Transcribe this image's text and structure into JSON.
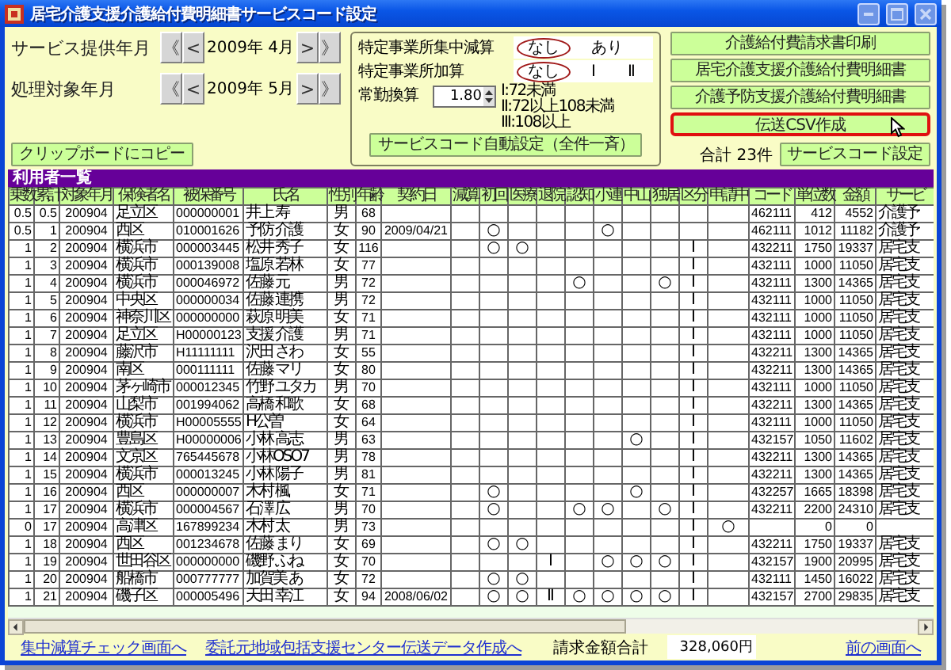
{
  "window": {
    "title": "居宅介護支援介護給付費明細書サービスコード設定"
  },
  "periods": [
    {
      "label": "サービス提供年月",
      "back_buttons": [
        "《",
        "<"
      ],
      "value": "2009年 4月",
      "forward_buttons": [
        ">",
        "》"
      ]
    },
    {
      "label": "処理対象年月",
      "back_buttons": [
        "《",
        "<"
      ],
      "value": "2009年 5月",
      "forward_buttons": [
        ">",
        "》"
      ]
    }
  ],
  "copy_button": "クリップボードにコピー",
  "settings_panel": {
    "concentration": {
      "label": "特定事業所集中減算",
      "options": [
        {
          "label": "なし",
          "selected": true
        },
        {
          "label": "あり",
          "selected": false
        }
      ]
    },
    "addition": {
      "label": "特定事業所加算",
      "options": [
        {
          "label": "なし",
          "selected": true
        },
        {
          "label": "Ⅰ",
          "selected": false
        },
        {
          "label": "Ⅱ",
          "selected": false
        }
      ]
    },
    "fte": {
      "label": "常勤換算",
      "value": "1.80"
    },
    "notes": [
      "Ⅰ:72未満",
      "Ⅱ:72以上108未満",
      "Ⅲ:108以上"
    ],
    "auto_button": "サービスコード自動設定（全件一斉）"
  },
  "action_buttons": [
    {
      "label": "介護給付費請求書印刷",
      "highlighted": false
    },
    {
      "label": "居宅介護支援介護給付費明細書",
      "highlighted": false
    },
    {
      "label": "介護予防支援介護給付費明細書",
      "highlighted": false
    },
    {
      "label": "伝送CSV作成",
      "highlighted": true
    }
  ],
  "total": "合計 23件",
  "service_code_button": "サービスコード設定",
  "user_list": {
    "title": "利用者一覧",
    "columns": [
      "乗数",
      "累計",
      "対象年月",
      "保険者名",
      "被保番号",
      "氏名",
      "性別",
      "年齢",
      "契約日",
      "減算",
      "初回",
      "医療",
      "退院",
      "認知",
      "小連",
      "中山",
      "独居",
      "区分",
      "申請中",
      "コード",
      "単位数",
      "金額",
      "サービ"
    ],
    "rows": [
      [
        "0.5",
        "0.5",
        "200904",
        "足立区",
        "000000001",
        "井上 寿",
        "男",
        "68",
        null,
        null,
        null,
        null,
        null,
        null,
        null,
        null,
        null,
        null,
        null,
        "462111",
        "412",
        "4552",
        "介護予"
      ],
      [
        "0.5",
        "1",
        "200904",
        "西区",
        "010001626",
        "予防 介護",
        "女",
        "90",
        "2009/04/21",
        null,
        "○",
        null,
        null,
        null,
        "○",
        null,
        null,
        null,
        null,
        "462111",
        "1012",
        "11182",
        "介護予"
      ],
      [
        "1",
        "2",
        "200904",
        "横浜市",
        "000003445",
        "松井 秀子",
        "女",
        "116",
        null,
        null,
        "○",
        "○",
        null,
        null,
        null,
        null,
        null,
        "Ⅰ",
        null,
        "432211",
        "1750",
        "19337",
        "居宅支"
      ],
      [
        "1",
        "3",
        "200904",
        "横浜市",
        "000139008",
        "塩原 若林",
        "女",
        "77",
        null,
        null,
        null,
        null,
        null,
        null,
        null,
        null,
        null,
        "Ⅰ",
        null,
        "432111",
        "1000",
        "11050",
        "居宅支"
      ],
      [
        "1",
        "4",
        "200904",
        "横浜市",
        "000046972",
        "佐藤 元",
        "男",
        "72",
        null,
        null,
        null,
        null,
        null,
        "○",
        null,
        null,
        "○",
        "Ⅰ",
        null,
        "432111",
        "1300",
        "14365",
        "居宅支"
      ],
      [
        "1",
        "5",
        "200904",
        "中央区",
        "000000034",
        "佐藤 連携",
        "男",
        "72",
        null,
        null,
        null,
        null,
        null,
        null,
        null,
        null,
        null,
        "Ⅰ",
        null,
        "432111",
        "1000",
        "11050",
        "居宅支"
      ],
      [
        "1",
        "6",
        "200904",
        "神奈川区",
        "000000000",
        "萩原 明美",
        "女",
        "71",
        null,
        null,
        null,
        null,
        null,
        null,
        null,
        null,
        null,
        "Ⅰ",
        null,
        "432111",
        "1000",
        "11050",
        "居宅支"
      ],
      [
        "1",
        "7",
        "200904",
        "足立区",
        "H00000123",
        "支援 介護",
        "男",
        "71",
        null,
        null,
        null,
        null,
        null,
        null,
        null,
        null,
        null,
        "Ⅰ",
        null,
        "432111",
        "1000",
        "11050",
        "居宅支"
      ],
      [
        "1",
        "8",
        "200904",
        "藤沢市",
        "H11111111",
        "沢田 さわ",
        "女",
        "55",
        null,
        null,
        null,
        null,
        null,
        null,
        null,
        null,
        null,
        "Ⅰ",
        null,
        "432211",
        "1300",
        "14365",
        "居宅支"
      ],
      [
        "1",
        "9",
        "200904",
        "南区",
        "000111111",
        "佐藤 マリ",
        "女",
        "80",
        null,
        null,
        null,
        null,
        null,
        null,
        null,
        null,
        null,
        "Ⅰ",
        null,
        "432211",
        "1300",
        "14365",
        "居宅支"
      ],
      [
        "1",
        "10",
        "200904",
        "茅ヶ崎市",
        "000012345",
        "竹野 ユタカ",
        "男",
        "70",
        null,
        null,
        null,
        null,
        null,
        null,
        null,
        null,
        null,
        "Ⅰ",
        null,
        "432111",
        "1000",
        "11050",
        "居宅支"
      ],
      [
        "1",
        "11",
        "200904",
        "山梨市",
        "001994062",
        "高橋 和歌",
        "女",
        "68",
        null,
        null,
        null,
        null,
        null,
        null,
        null,
        null,
        null,
        "Ⅰ",
        null,
        "432211",
        "1300",
        "14365",
        "居宅支"
      ],
      [
        "1",
        "12",
        "200904",
        "横浜市",
        "H00005555",
        "H公曽",
        "女",
        "64",
        null,
        null,
        null,
        null,
        null,
        null,
        null,
        null,
        null,
        "Ⅰ",
        null,
        "432111",
        "1000",
        "11050",
        "居宅支"
      ],
      [
        "1",
        "13",
        "200904",
        "豊島区",
        "H00000006",
        "小林 高志",
        "男",
        "63",
        null,
        null,
        null,
        null,
        null,
        null,
        null,
        "○",
        null,
        "Ⅰ",
        null,
        "432157",
        "1050",
        "11602",
        "居宅支"
      ],
      [
        "1",
        "14",
        "200904",
        "文京区",
        "765445678",
        "小林OSO7",
        "男",
        "78",
        null,
        null,
        null,
        null,
        null,
        null,
        null,
        null,
        null,
        "Ⅰ",
        null,
        "432211",
        "1300",
        "14365",
        "居宅支"
      ],
      [
        "1",
        "15",
        "200904",
        "横浜市",
        "000013245",
        "小林 陽子",
        "男",
        "81",
        null,
        null,
        null,
        null,
        null,
        null,
        null,
        null,
        null,
        "Ⅰ",
        null,
        "432211",
        "1300",
        "14365",
        "居宅支"
      ],
      [
        "1",
        "16",
        "200904",
        "西区",
        "000000007",
        "木村 楓",
        "女",
        "71",
        null,
        null,
        "○",
        null,
        null,
        null,
        null,
        "○",
        null,
        "Ⅰ",
        null,
        "432257",
        "1665",
        "18398",
        "居宅支"
      ],
      [
        "1",
        "17",
        "200904",
        "横浜市",
        "000004567",
        "石澤 広",
        "男",
        "70",
        null,
        null,
        "○",
        null,
        null,
        "○",
        "○",
        null,
        "○",
        "Ⅰ",
        null,
        "432211",
        "2200",
        "24310",
        "居宅支"
      ],
      [
        "0",
        "17",
        "200904",
        "高津区",
        "167899234",
        "木村 太",
        "男",
        "73",
        null,
        null,
        null,
        null,
        null,
        null,
        null,
        null,
        null,
        "Ⅰ",
        "○",
        null,
        "0",
        "0",
        null
      ],
      [
        "1",
        "18",
        "200904",
        "西区",
        "001234678",
        "佐藤 まり",
        "女",
        "69",
        null,
        null,
        "○",
        "○",
        null,
        null,
        null,
        null,
        null,
        "Ⅰ",
        null,
        "432211",
        "1750",
        "19337",
        "居宅支"
      ],
      [
        "1",
        "19",
        "200904",
        "世田谷区",
        "000000000",
        "磯野 ふね",
        "女",
        "70",
        null,
        null,
        null,
        null,
        "Ⅰ",
        null,
        "○",
        "○",
        "○",
        "Ⅰ",
        null,
        "432157",
        "1900",
        "20995",
        "居宅支"
      ],
      [
        "1",
        "20",
        "200904",
        "船橋市",
        "000777777",
        "加賀美 あ",
        "女",
        "72",
        null,
        null,
        "○",
        "○",
        null,
        null,
        null,
        null,
        null,
        "Ⅰ",
        null,
        "432111",
        "1450",
        "16022",
        "居宅支"
      ],
      [
        "1",
        "21",
        "200904",
        "磯子区",
        "000005496",
        "天田 幸江",
        "女",
        "94",
        "2008/06/02",
        null,
        "○",
        "○",
        "Ⅱ",
        "○",
        "○",
        "○",
        "○",
        "Ⅰ",
        null,
        "432157",
        "2700",
        "29835",
        "居宅支"
      ]
    ]
  },
  "bottom": {
    "links": [
      "集中減算チェック画面へ",
      "委託元地域包括支援センター伝送データ作成へ"
    ],
    "billing_total": {
      "label": "請求金額合計",
      "value": "328,060円"
    },
    "back_link": "前の画面へ"
  }
}
